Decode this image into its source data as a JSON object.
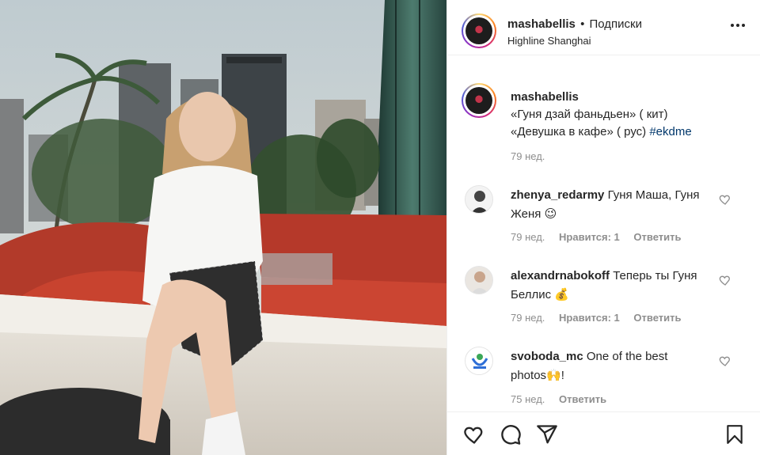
{
  "header": {
    "username": "mashabellis",
    "separator": "•",
    "follow_label": "Подписки",
    "location": "Highline Shanghai"
  },
  "caption": {
    "username": "mashabellis",
    "line1": "«Гуня дзай фаньдьен» ( кит)",
    "line2_text": "«Девушка в кафе» ( рус) ",
    "hashtag": "#ekdme",
    "time": "79 нед."
  },
  "comments": [
    {
      "username": "zhenya_redarmy",
      "text": "Гуня Маша, Гуня Женя 😉",
      "time": "79 нед.",
      "likes": "Нравится: 1",
      "reply": "Ответить"
    },
    {
      "username": "alexandrnabokoff",
      "text": "Теперь ты Гуня Беллис 💰",
      "time": "79 нед.",
      "likes": "Нравится: 1",
      "reply": "Ответить"
    },
    {
      "username": "svoboda_mc",
      "text": "One of the best photos🙌!",
      "time": "75 нед.",
      "reply": "Ответить"
    }
  ],
  "icons": {
    "more": "more-options-icon",
    "like": "heart-icon",
    "comment": "comment-icon",
    "share": "paper-plane-icon",
    "save": "bookmark-icon",
    "comment_like": "small-heart-icon"
  },
  "colors": {
    "text": "#262626",
    "secondary": "#8e8e8e",
    "hashtag": "#00376b",
    "border": "#efefef"
  }
}
